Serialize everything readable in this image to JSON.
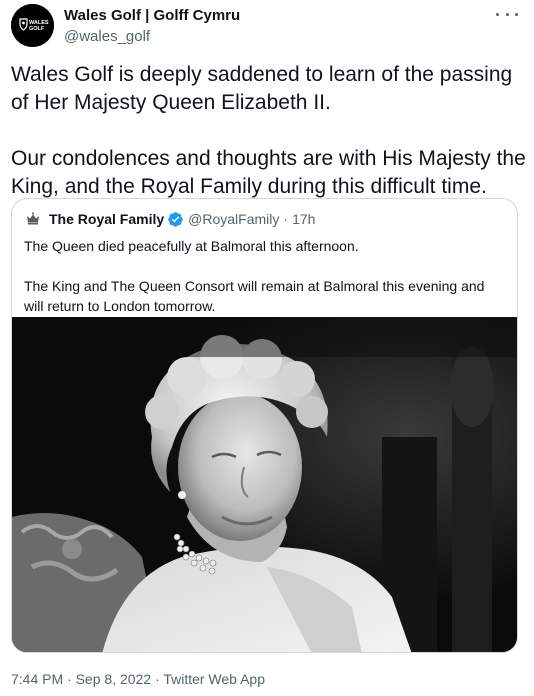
{
  "author": {
    "display_name": "Wales Golf | Golff Cymru",
    "handle": "@wales_golf",
    "avatar_logo_text": "WALES GOLF",
    "avatar_icon": "wales-golf-logo"
  },
  "more_icon": "more-horizontal-icon",
  "tweet": {
    "paragraphs": [
      "Wales Golf is deeply saddened to learn of the passing of Her Majesty Queen Elizabeth II.",
      "Our condolences and thoughts are with His Majesty the King, and the Royal Family during this difficult time."
    ]
  },
  "quoted": {
    "display_name": "The Royal Family",
    "handle": "@RoyalFamily",
    "separator": "·",
    "time": "17h",
    "verified_icon": "verified-badge-icon",
    "avatar_icon": "royal-crest-icon",
    "paragraphs": [
      "The Queen died peacefully at Balmoral this afternoon.",
      "The King and The Queen Consort will remain at Balmoral this evening and will return to London tomorrow."
    ],
    "photo_description_icon": "black-and-white-portrait-photo"
  },
  "footer": {
    "time": "7:44 PM",
    "sep1": "·",
    "date": "Sep 8, 2022",
    "sep2": "·",
    "source": "Twitter Web App"
  },
  "colors": {
    "text": "#0f1419",
    "secondary": "#536471",
    "border": "#cfd9de",
    "verified": "#1d9bf0"
  }
}
